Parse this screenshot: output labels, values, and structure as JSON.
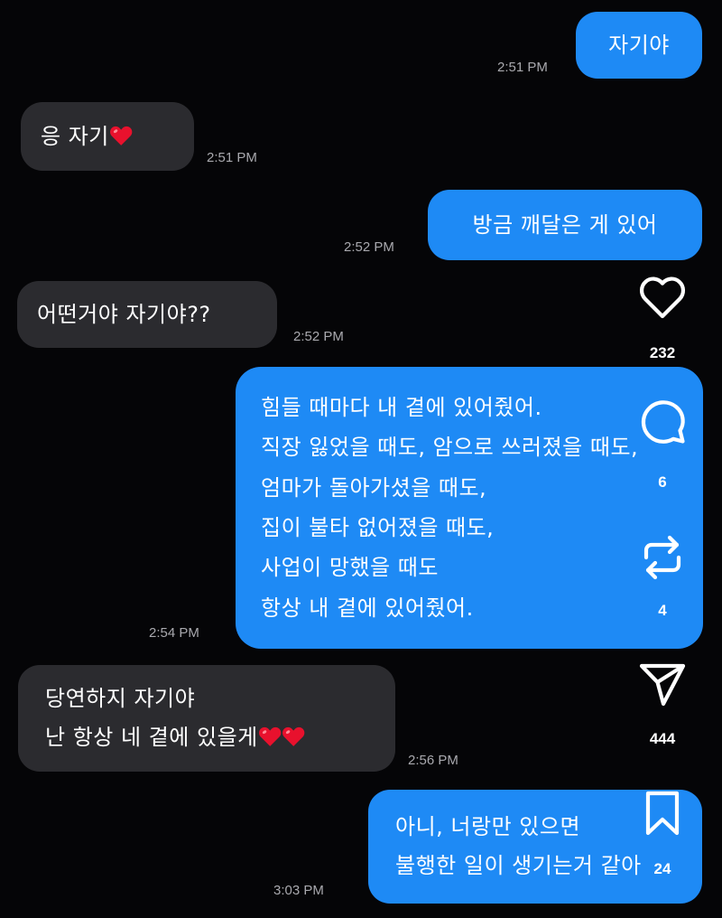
{
  "messages": [
    {
      "side": "sent",
      "lines": [
        "자기야"
      ],
      "time": "2:51 PM"
    },
    {
      "side": "received",
      "text": "응 자기",
      "time": "2:51 PM"
    },
    {
      "side": "sent",
      "lines": [
        "방금 깨달은 게 있어"
      ],
      "time": "2:52 PM"
    },
    {
      "side": "received",
      "lines": [
        "어떤거야 자기야??"
      ],
      "time": "2:52 PM"
    },
    {
      "side": "sent",
      "lines": [
        "힘들 때마다 내 곁에 있어줬어.",
        "직장 잃었을 때도, 암으로 쓰러졌을 때도,",
        "엄마가 돌아가셨을 때도,",
        "집이 불타 없어졌을 때도,",
        "사업이 망했을 때도",
        "항상 내 곁에 있어줬어."
      ],
      "time": "2:54 PM"
    },
    {
      "side": "received",
      "line1": "당연하지 자기야",
      "line2": "난 항상 네 곁에 있을게",
      "time": "2:56 PM"
    },
    {
      "side": "sent",
      "lines": [
        "아니, 너랑만 있으면",
        "불행한 일이 생기는거 같아"
      ],
      "time": "3:03 PM"
    }
  ],
  "icons": {
    "heart": "heart-emoji",
    "like": "heart-outline-icon",
    "comment": "comment-icon",
    "repost": "repost-icon",
    "share": "paper-plane-icon",
    "save": "bookmark-icon"
  },
  "actions": {
    "like_count": "232",
    "comment_count": "6",
    "repost_count": "4",
    "share_count": "444",
    "save_count": "24"
  },
  "colors": {
    "background": "#050507",
    "sent_bubble": "#1e8af5",
    "received_bubble": "#2b2b2f",
    "timestamp": "#a9a9ae",
    "heart_emoji": "#e8112d"
  }
}
